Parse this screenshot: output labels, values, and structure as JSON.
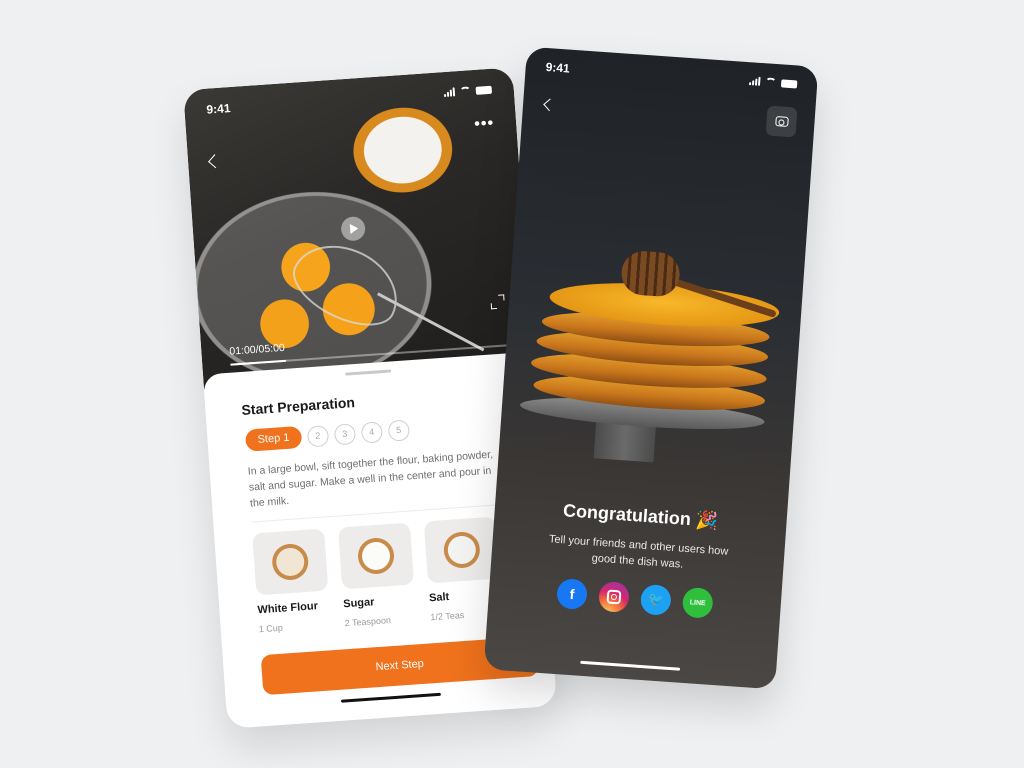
{
  "recipe_screen": {
    "status": {
      "time": "9:41"
    },
    "video": {
      "timecode": "01:00/05:00",
      "progress": 0.2
    },
    "title": "Start Preparation",
    "steps": {
      "active": "Step 1",
      "others": [
        "2",
        "3",
        "4",
        "5"
      ]
    },
    "instructions": "In a large bowl, sift together the flour, baking powder, salt and sugar. Make a well in the center and pour in the milk.",
    "ingredients": [
      {
        "name": "White Flour",
        "quantity": "1 Cup",
        "color": "#f1e6d4"
      },
      {
        "name": "Sugar",
        "quantity": "2 Teaspoon",
        "color": "#fbfbf8"
      },
      {
        "name": "Salt",
        "quantity": "1/2 Teas",
        "color": "#f3f3f1"
      }
    ],
    "next_button": "Next Step"
  },
  "congrats_screen": {
    "status": {
      "time": "9:41"
    },
    "title": "Congratulation 🎉",
    "message": "Tell your friends and other users how good the dish was.",
    "socials": [
      {
        "icon": "facebook-icon",
        "glyph": "f"
      },
      {
        "icon": "instagram-icon",
        "glyph": ""
      },
      {
        "icon": "twitter-icon",
        "glyph": "🐦"
      },
      {
        "icon": "line-icon",
        "glyph": "LINE"
      }
    ]
  },
  "colors": {
    "accent": "#f0721c",
    "background": "#eef0f2"
  }
}
